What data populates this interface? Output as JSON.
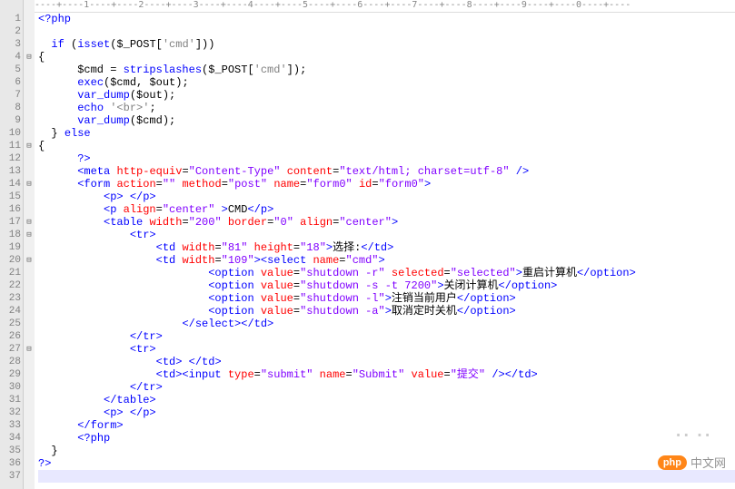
{
  "ruler": "----+----1----+----2----+----3----+----4----+----5----+----6----+----7----+----8----+----9----+----0----+----",
  "watermark": {
    "badge": "php",
    "text": "中文网"
  },
  "lines": [
    {
      "n": 1,
      "f": "",
      "tokens": [
        {
          "c": "c-kw",
          "t": "<?php"
        }
      ]
    },
    {
      "n": 2,
      "f": "",
      "tokens": [
        {
          "c": "c-default",
          "t": ""
        }
      ]
    },
    {
      "n": 3,
      "f": "",
      "tokens": [
        {
          "c": "c-default",
          "t": "  "
        },
        {
          "c": "c-kw",
          "t": "if"
        },
        {
          "c": "c-default",
          "t": " ("
        },
        {
          "c": "c-kw",
          "t": "isset"
        },
        {
          "c": "c-default",
          "t": "($_POST["
        },
        {
          "c": "c-str",
          "t": "'cmd'"
        },
        {
          "c": "c-default",
          "t": "]))"
        }
      ]
    },
    {
      "n": 4,
      "f": "⊟",
      "tokens": [
        {
          "c": "c-default",
          "t": "{"
        }
      ]
    },
    {
      "n": 5,
      "f": "",
      "tokens": [
        {
          "c": "c-default",
          "t": "      $cmd = "
        },
        {
          "c": "c-kw",
          "t": "stripslashes"
        },
        {
          "c": "c-default",
          "t": "($_POST["
        },
        {
          "c": "c-str",
          "t": "'cmd'"
        },
        {
          "c": "c-default",
          "t": "]);"
        }
      ]
    },
    {
      "n": 6,
      "f": "",
      "tokens": [
        {
          "c": "c-default",
          "t": "      "
        },
        {
          "c": "c-kw",
          "t": "exec"
        },
        {
          "c": "c-default",
          "t": "($cmd, $out);"
        }
      ]
    },
    {
      "n": 7,
      "f": "",
      "tokens": [
        {
          "c": "c-default",
          "t": "      "
        },
        {
          "c": "c-kw",
          "t": "var_dump"
        },
        {
          "c": "c-default",
          "t": "($out);"
        }
      ]
    },
    {
      "n": 8,
      "f": "",
      "tokens": [
        {
          "c": "c-default",
          "t": "      "
        },
        {
          "c": "c-kw",
          "t": "echo"
        },
        {
          "c": "c-default",
          "t": " "
        },
        {
          "c": "c-str",
          "t": "'<br>'"
        },
        {
          "c": "c-default",
          "t": ";"
        }
      ]
    },
    {
      "n": 9,
      "f": "",
      "tokens": [
        {
          "c": "c-default",
          "t": "      "
        },
        {
          "c": "c-kw",
          "t": "var_dump"
        },
        {
          "c": "c-default",
          "t": "($cmd);"
        }
      ]
    },
    {
      "n": 10,
      "f": "",
      "tokens": [
        {
          "c": "c-default",
          "t": "  } "
        },
        {
          "c": "c-kw",
          "t": "else"
        }
      ]
    },
    {
      "n": 11,
      "f": "⊟",
      "tokens": [
        {
          "c": "c-default",
          "t": "{"
        }
      ]
    },
    {
      "n": 12,
      "f": "",
      "tokens": [
        {
          "c": "c-default",
          "t": "      "
        },
        {
          "c": "c-kw",
          "t": "?>"
        }
      ]
    },
    {
      "n": 13,
      "f": "",
      "tokens": [
        {
          "c": "c-default",
          "t": "      "
        },
        {
          "c": "c-tag",
          "t": "<meta"
        },
        {
          "c": "c-default",
          "t": " "
        },
        {
          "c": "c-attr",
          "t": "http-equiv"
        },
        {
          "c": "c-default",
          "t": "="
        },
        {
          "c": "c-val",
          "t": "\"Content-Type\""
        },
        {
          "c": "c-default",
          "t": " "
        },
        {
          "c": "c-attr",
          "t": "content"
        },
        {
          "c": "c-default",
          "t": "="
        },
        {
          "c": "c-val",
          "t": "\"text/html; charset=utf-8\""
        },
        {
          "c": "c-default",
          "t": " "
        },
        {
          "c": "c-tag",
          "t": "/>"
        }
      ]
    },
    {
      "n": 14,
      "f": "⊟",
      "tokens": [
        {
          "c": "c-default",
          "t": "      "
        },
        {
          "c": "c-tag",
          "t": "<form"
        },
        {
          "c": "c-default",
          "t": " "
        },
        {
          "c": "c-attr",
          "t": "action"
        },
        {
          "c": "c-default",
          "t": "="
        },
        {
          "c": "c-val",
          "t": "\"\""
        },
        {
          "c": "c-default",
          "t": " "
        },
        {
          "c": "c-attr",
          "t": "method"
        },
        {
          "c": "c-default",
          "t": "="
        },
        {
          "c": "c-val",
          "t": "\"post\""
        },
        {
          "c": "c-default",
          "t": " "
        },
        {
          "c": "c-attr",
          "t": "name"
        },
        {
          "c": "c-default",
          "t": "="
        },
        {
          "c": "c-val",
          "t": "\"form0\""
        },
        {
          "c": "c-default",
          "t": " "
        },
        {
          "c": "c-attr",
          "t": "id"
        },
        {
          "c": "c-default",
          "t": "="
        },
        {
          "c": "c-val",
          "t": "\"form0\""
        },
        {
          "c": "c-tag",
          "t": ">"
        }
      ]
    },
    {
      "n": 15,
      "f": "",
      "tokens": [
        {
          "c": "c-default",
          "t": "          "
        },
        {
          "c": "c-tag",
          "t": "<p>"
        },
        {
          "c": "c-default",
          "t": " "
        },
        {
          "c": "c-tag",
          "t": "</p>"
        }
      ]
    },
    {
      "n": 16,
      "f": "",
      "tokens": [
        {
          "c": "c-default",
          "t": "          "
        },
        {
          "c": "c-tag",
          "t": "<p"
        },
        {
          "c": "c-default",
          "t": " "
        },
        {
          "c": "c-attr",
          "t": "align"
        },
        {
          "c": "c-default",
          "t": "="
        },
        {
          "c": "c-val",
          "t": "\"center\""
        },
        {
          "c": "c-default",
          "t": " "
        },
        {
          "c": "c-tag",
          "t": ">"
        },
        {
          "c": "c-txt",
          "t": "CMD"
        },
        {
          "c": "c-tag",
          "t": "</p>"
        }
      ]
    },
    {
      "n": 17,
      "f": "⊟",
      "tokens": [
        {
          "c": "c-default",
          "t": "          "
        },
        {
          "c": "c-tag",
          "t": "<table"
        },
        {
          "c": "c-default",
          "t": " "
        },
        {
          "c": "c-attr",
          "t": "width"
        },
        {
          "c": "c-default",
          "t": "="
        },
        {
          "c": "c-val",
          "t": "\"200\""
        },
        {
          "c": "c-default",
          "t": " "
        },
        {
          "c": "c-attr",
          "t": "border"
        },
        {
          "c": "c-default",
          "t": "="
        },
        {
          "c": "c-val",
          "t": "\"0\""
        },
        {
          "c": "c-default",
          "t": " "
        },
        {
          "c": "c-attr",
          "t": "align"
        },
        {
          "c": "c-default",
          "t": "="
        },
        {
          "c": "c-val",
          "t": "\"center\""
        },
        {
          "c": "c-tag",
          "t": ">"
        }
      ]
    },
    {
      "n": 18,
      "f": "⊟",
      "tokens": [
        {
          "c": "c-default",
          "t": "              "
        },
        {
          "c": "c-tag",
          "t": "<tr>"
        }
      ]
    },
    {
      "n": 19,
      "f": "",
      "tokens": [
        {
          "c": "c-default",
          "t": "                  "
        },
        {
          "c": "c-tag",
          "t": "<td"
        },
        {
          "c": "c-default",
          "t": " "
        },
        {
          "c": "c-attr",
          "t": "width"
        },
        {
          "c": "c-default",
          "t": "="
        },
        {
          "c": "c-val",
          "t": "\"81\""
        },
        {
          "c": "c-default",
          "t": " "
        },
        {
          "c": "c-attr",
          "t": "height"
        },
        {
          "c": "c-default",
          "t": "="
        },
        {
          "c": "c-val",
          "t": "\"18\""
        },
        {
          "c": "c-tag",
          "t": ">"
        },
        {
          "c": "c-txt",
          "t": "选择:"
        },
        {
          "c": "c-tag",
          "t": "</td>"
        }
      ]
    },
    {
      "n": 20,
      "f": "⊟",
      "tokens": [
        {
          "c": "c-default",
          "t": "                  "
        },
        {
          "c": "c-tag",
          "t": "<td"
        },
        {
          "c": "c-default",
          "t": " "
        },
        {
          "c": "c-attr",
          "t": "width"
        },
        {
          "c": "c-default",
          "t": "="
        },
        {
          "c": "c-val",
          "t": "\"109\""
        },
        {
          "c": "c-tag",
          "t": "><select"
        },
        {
          "c": "c-default",
          "t": " "
        },
        {
          "c": "c-attr",
          "t": "name"
        },
        {
          "c": "c-default",
          "t": "="
        },
        {
          "c": "c-val",
          "t": "\"cmd\""
        },
        {
          "c": "c-tag",
          "t": ">"
        }
      ]
    },
    {
      "n": 21,
      "f": "",
      "tokens": [
        {
          "c": "c-default",
          "t": "                          "
        },
        {
          "c": "c-tag",
          "t": "<option"
        },
        {
          "c": "c-default",
          "t": " "
        },
        {
          "c": "c-attr",
          "t": "value"
        },
        {
          "c": "c-default",
          "t": "="
        },
        {
          "c": "c-val",
          "t": "\"shutdown -r\""
        },
        {
          "c": "c-default",
          "t": " "
        },
        {
          "c": "c-attr",
          "t": "selected"
        },
        {
          "c": "c-default",
          "t": "="
        },
        {
          "c": "c-val",
          "t": "\"selected\""
        },
        {
          "c": "c-tag",
          "t": ">"
        },
        {
          "c": "c-txt",
          "t": "重启计算机"
        },
        {
          "c": "c-tag",
          "t": "</option>"
        }
      ]
    },
    {
      "n": 22,
      "f": "",
      "tokens": [
        {
          "c": "c-default",
          "t": "                          "
        },
        {
          "c": "c-tag",
          "t": "<option"
        },
        {
          "c": "c-default",
          "t": " "
        },
        {
          "c": "c-attr",
          "t": "value"
        },
        {
          "c": "c-default",
          "t": "="
        },
        {
          "c": "c-val",
          "t": "\"shutdown -s -t 7200\""
        },
        {
          "c": "c-tag",
          "t": ">"
        },
        {
          "c": "c-txt",
          "t": "关闭计算机"
        },
        {
          "c": "c-tag",
          "t": "</option>"
        }
      ]
    },
    {
      "n": 23,
      "f": "",
      "tokens": [
        {
          "c": "c-default",
          "t": "                          "
        },
        {
          "c": "c-tag",
          "t": "<option"
        },
        {
          "c": "c-default",
          "t": " "
        },
        {
          "c": "c-attr",
          "t": "value"
        },
        {
          "c": "c-default",
          "t": "="
        },
        {
          "c": "c-val",
          "t": "\"shutdown -l\""
        },
        {
          "c": "c-tag",
          "t": ">"
        },
        {
          "c": "c-txt",
          "t": "注销当前用户"
        },
        {
          "c": "c-tag",
          "t": "</option>"
        }
      ]
    },
    {
      "n": 24,
      "f": "",
      "tokens": [
        {
          "c": "c-default",
          "t": "                          "
        },
        {
          "c": "c-tag",
          "t": "<option"
        },
        {
          "c": "c-default",
          "t": " "
        },
        {
          "c": "c-attr",
          "t": "value"
        },
        {
          "c": "c-default",
          "t": "="
        },
        {
          "c": "c-val",
          "t": "\"shutdown -a\""
        },
        {
          "c": "c-tag",
          "t": ">"
        },
        {
          "c": "c-txt",
          "t": "取消定时关机"
        },
        {
          "c": "c-tag",
          "t": "</option>"
        }
      ]
    },
    {
      "n": 25,
      "f": "",
      "tokens": [
        {
          "c": "c-default",
          "t": "                      "
        },
        {
          "c": "c-tag",
          "t": "</select></td>"
        }
      ]
    },
    {
      "n": 26,
      "f": "",
      "tokens": [
        {
          "c": "c-default",
          "t": "              "
        },
        {
          "c": "c-tag",
          "t": "</tr>"
        }
      ]
    },
    {
      "n": 27,
      "f": "⊟",
      "tokens": [
        {
          "c": "c-default",
          "t": "              "
        },
        {
          "c": "c-tag",
          "t": "<tr>"
        }
      ]
    },
    {
      "n": 28,
      "f": "",
      "tokens": [
        {
          "c": "c-default",
          "t": "                  "
        },
        {
          "c": "c-tag",
          "t": "<td>"
        },
        {
          "c": "c-default",
          "t": " "
        },
        {
          "c": "c-tag",
          "t": "</td>"
        }
      ]
    },
    {
      "n": 29,
      "f": "",
      "tokens": [
        {
          "c": "c-default",
          "t": "                  "
        },
        {
          "c": "c-tag",
          "t": "<td><input"
        },
        {
          "c": "c-default",
          "t": " "
        },
        {
          "c": "c-attr",
          "t": "type"
        },
        {
          "c": "c-default",
          "t": "="
        },
        {
          "c": "c-val",
          "t": "\"submit\""
        },
        {
          "c": "c-default",
          "t": " "
        },
        {
          "c": "c-attr",
          "t": "name"
        },
        {
          "c": "c-default",
          "t": "="
        },
        {
          "c": "c-val",
          "t": "\"Submit\""
        },
        {
          "c": "c-default",
          "t": " "
        },
        {
          "c": "c-attr",
          "t": "value"
        },
        {
          "c": "c-default",
          "t": "="
        },
        {
          "c": "c-val",
          "t": "\"提交\""
        },
        {
          "c": "c-default",
          "t": " "
        },
        {
          "c": "c-tag",
          "t": "/></td>"
        }
      ]
    },
    {
      "n": 30,
      "f": "",
      "tokens": [
        {
          "c": "c-default",
          "t": "              "
        },
        {
          "c": "c-tag",
          "t": "</tr>"
        }
      ]
    },
    {
      "n": 31,
      "f": "",
      "tokens": [
        {
          "c": "c-default",
          "t": "          "
        },
        {
          "c": "c-tag",
          "t": "</table>"
        }
      ]
    },
    {
      "n": 32,
      "f": "",
      "tokens": [
        {
          "c": "c-default",
          "t": "          "
        },
        {
          "c": "c-tag",
          "t": "<p>"
        },
        {
          "c": "c-default",
          "t": " "
        },
        {
          "c": "c-tag",
          "t": "</p>"
        }
      ]
    },
    {
      "n": 33,
      "f": "",
      "tokens": [
        {
          "c": "c-default",
          "t": "      "
        },
        {
          "c": "c-tag",
          "t": "</form>"
        }
      ]
    },
    {
      "n": 34,
      "f": "",
      "tokens": [
        {
          "c": "c-default",
          "t": "      "
        },
        {
          "c": "c-kw",
          "t": "<?php"
        }
      ]
    },
    {
      "n": 35,
      "f": "",
      "tokens": [
        {
          "c": "c-default",
          "t": "  }"
        }
      ]
    },
    {
      "n": 36,
      "f": "",
      "tokens": [
        {
          "c": "c-kw",
          "t": "?>"
        }
      ]
    },
    {
      "n": 37,
      "f": "",
      "tokens": [
        {
          "c": "c-default",
          "t": ""
        }
      ],
      "cur": true
    }
  ]
}
